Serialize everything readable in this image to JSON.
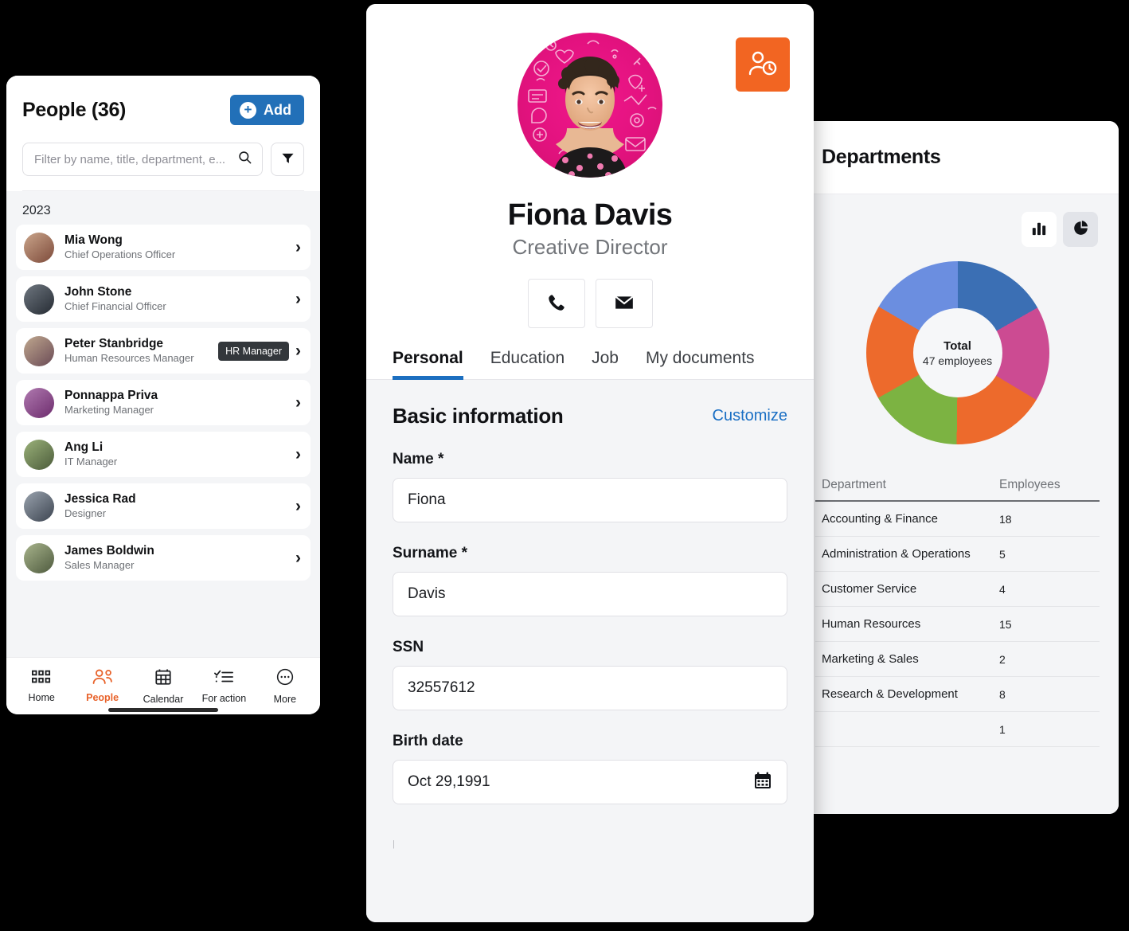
{
  "left_panel": {
    "title": "People (36)",
    "add_label": "Add",
    "search": {
      "placeholder": "Filter by name, title, department, e...",
      "value": ""
    },
    "group_label": "2023",
    "people": [
      {
        "name": "Mia Wong",
        "role": "Chief Operations Officer",
        "badge": ""
      },
      {
        "name": "John Stone",
        "role": "Chief Financial Officer",
        "badge": ""
      },
      {
        "name": "Peter Stanbridge",
        "role": "Human Resources Manager",
        "badge": "HR Manager"
      },
      {
        "name": "Ponnappa Priva",
        "role": "Marketing Manager",
        "badge": ""
      },
      {
        "name": "Ang Li",
        "role": "IT Manager",
        "badge": ""
      },
      {
        "name": "Jessica Rad",
        "role": "Designer",
        "badge": ""
      },
      {
        "name": "James Boldwin",
        "role": "Sales Manager",
        "badge": ""
      }
    ],
    "nav": [
      {
        "label": "Home",
        "icon": "grid-icon",
        "active": false
      },
      {
        "label": "People",
        "icon": "people-icon",
        "active": true
      },
      {
        "label": "Calendar",
        "icon": "calendar-icon",
        "active": false
      },
      {
        "label": "For action",
        "icon": "checklist-icon",
        "active": false
      },
      {
        "label": "More",
        "icon": "ellipsis-icon",
        "active": false
      }
    ]
  },
  "center_panel": {
    "name": "Fiona Davis",
    "role": "Creative Director",
    "tabs": [
      {
        "label": "Personal",
        "active": true
      },
      {
        "label": "Education",
        "active": false
      },
      {
        "label": "Job",
        "active": false
      },
      {
        "label": "My documents",
        "active": false
      }
    ],
    "section_title": "Basic information",
    "customize_label": "Customize",
    "fields": [
      {
        "label": "Name *",
        "value": "Fiona",
        "icon": ""
      },
      {
        "label": "Surname *",
        "value": "Davis",
        "icon": ""
      },
      {
        "label": "SSN",
        "value": "32557612",
        "icon": ""
      },
      {
        "label": "Birth date",
        "value": "Oct 29,1991",
        "icon": "calendar-icon"
      }
    ]
  },
  "right_panel": {
    "title": "Departments",
    "toggles": [
      {
        "icon": "bar-chart-icon",
        "active": false
      },
      {
        "icon": "pie-chart-icon",
        "active": true
      }
    ],
    "columns": [
      "Department",
      "Employees"
    ]
  },
  "chart_data": {
    "type": "pie",
    "title": "Departments",
    "center_label": "Total",
    "center_value": "47 employees",
    "total": 47,
    "categories": [
      "Accounting & Finance",
      "Administration & Operations",
      "Customer Service",
      "Human Resources",
      "Marketing & Sales",
      "Research & Development",
      ""
    ],
    "values": [
      18,
      5,
      4,
      15,
      2,
      8,
      1
    ],
    "slice_colors": [
      "#3b6fb4",
      "#cc4b92",
      "#ed6a2c",
      "#7cb342",
      "#ed6a2c",
      "#6b8ee0"
    ],
    "legend": "none",
    "donut": true
  },
  "colors": {
    "accent_blue": "#2270b8",
    "accent_orange": "#f26522",
    "link_blue": "#1a6fc4",
    "tab_underline": "#1c6fc0"
  }
}
